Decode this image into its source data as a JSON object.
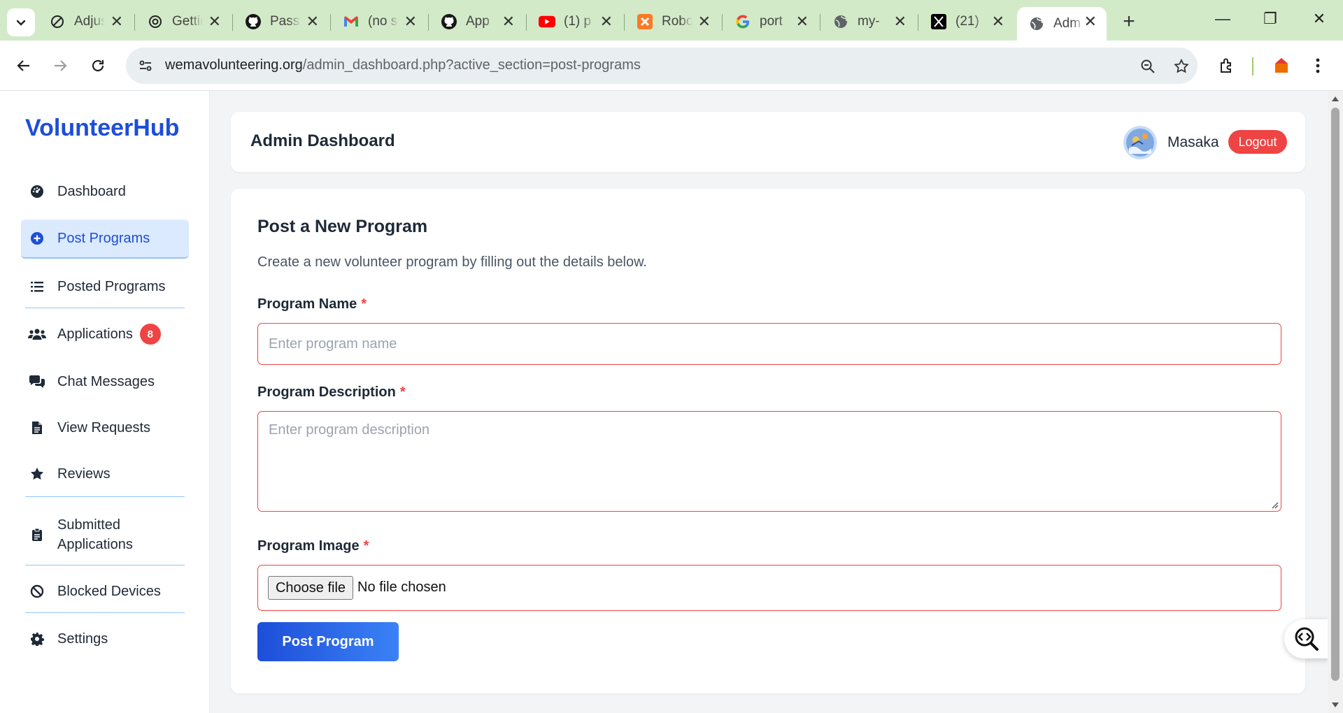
{
  "browser": {
    "tabs": [
      {
        "title": "Adjust",
        "icon": "adjust-icon"
      },
      {
        "title": "Getting started",
        "icon": "openai-icon"
      },
      {
        "title": "Password",
        "icon": "github-icon"
      },
      {
        "title": "(no subject)",
        "icon": "gmail-icon"
      },
      {
        "title": "App",
        "icon": "github-icon"
      },
      {
        "title": "(1) p",
        "icon": "youtube-icon"
      },
      {
        "title": "Robot",
        "icon": "xampp-icon"
      },
      {
        "title": "port",
        "icon": "google-icon"
      },
      {
        "title": "my-",
        "icon": "globe-icon"
      },
      {
        "title": "(21)",
        "icon": "x-icon"
      },
      {
        "title": "Adm",
        "icon": "globe-icon"
      }
    ],
    "url_host": "wemavolunteering.org",
    "url_path": "/admin_dashboard.php?active_section=post-programs"
  },
  "brand": "VolunteerHub",
  "sidebar": {
    "items": [
      {
        "label": "Dashboard",
        "icon": "dashboard-icon"
      },
      {
        "label": "Post Programs",
        "icon": "plus-circle-icon"
      },
      {
        "label": "Posted Programs",
        "icon": "list-icon"
      },
      {
        "label": "Applications",
        "icon": "users-icon",
        "badge": "8"
      },
      {
        "label": "Chat Messages",
        "icon": "chat-icon"
      },
      {
        "label": "View Requests",
        "icon": "file-icon"
      },
      {
        "label": "Reviews",
        "icon": "star-icon"
      },
      {
        "label": "Submitted Applications",
        "icon": "clipboard-icon"
      },
      {
        "label": "Blocked Devices",
        "icon": "ban-icon"
      },
      {
        "label": "Settings",
        "icon": "gear-icon"
      }
    ]
  },
  "header": {
    "title": "Admin Dashboard",
    "username": "Masaka",
    "logout_label": "Logout"
  },
  "form": {
    "title": "Post a New Program",
    "subtitle": "Create a new volunteer program by filling out the details below.",
    "name_label": "Program Name",
    "name_placeholder": "Enter program name",
    "description_label": "Program Description",
    "description_placeholder": "Enter program description",
    "image_label": "Program Image",
    "choose_file_label": "Choose file",
    "no_file_text": "No file chosen",
    "required_marker": "*",
    "submit_label": "Post Program"
  },
  "colors": {
    "brand": "#1d4ed8",
    "danger": "#ef4444",
    "tabbar": "#d3eac8"
  }
}
